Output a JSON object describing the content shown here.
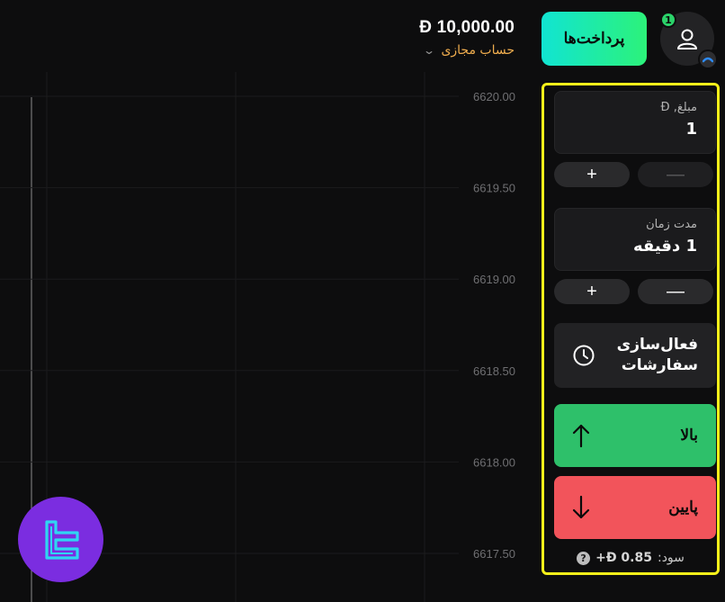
{
  "header": {
    "balance": "Đ 10,000.00",
    "account_type": "حساب مجازی",
    "pay_button": "پرداخت‌ها",
    "notification_count": "1"
  },
  "panel": {
    "amount_label": "مبلغ, Đ",
    "amount_value": "1",
    "duration_label": "مدت زمان",
    "duration_value": "1 دقیقه",
    "plus": "+",
    "minus": "—",
    "orders_line1": "فعال‌سازی",
    "orders_line2": "سفارشات",
    "up_label": "بالا",
    "down_label": "پایین",
    "profit_label": "سود:",
    "profit_value": "+Đ 0.85",
    "help_icon": "?"
  },
  "colors": {
    "up": "#2ec06a",
    "down": "#f2545b",
    "panel_highlight": "#f6f01a",
    "account_text": "#f0ad4e"
  },
  "chart_data": {
    "type": "line",
    "y_ticks": [
      "6620.00",
      "6619.50",
      "6619.00",
      "6618.50",
      "6618.00",
      "6617.50"
    ],
    "y_values": [
      6620.0,
      6619.5,
      6619.0,
      6618.5,
      6618.0,
      6617.5
    ],
    "ylim": [
      6617.5,
      6620.0
    ],
    "grid": true,
    "series": []
  }
}
